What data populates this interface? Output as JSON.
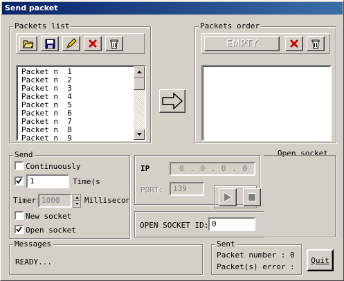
{
  "window": {
    "title": "Send packet",
    "close_glyph": "×"
  },
  "packets_list": {
    "legend": "Packets list",
    "items": [
      "Packet n  1",
      "Packet n  2",
      "Packet n  3",
      "Packet n  4",
      "Packet n  5",
      "Packet n  6",
      "Packet n  7",
      "Packet n  8",
      "Packet n  9"
    ],
    "toolbar_icons": [
      "open-folder-icon",
      "save-disk-icon",
      "edit-pencil-icon",
      "delete-x-icon",
      "trash-icon"
    ]
  },
  "packets_order": {
    "legend": "Packets order",
    "empty_label": "EMPTY"
  },
  "send": {
    "legend": "Send",
    "continuously_label": "Continuously",
    "continuously_checked": false,
    "times_checked": true,
    "times_value": "1",
    "times_label": "Time(s",
    "timer_label": "Timer:",
    "timer_value": "1000",
    "timer_unit": "Millisecond",
    "new_socket_label": "New socket",
    "new_socket_checked": false,
    "open_socket_label": "Open socket",
    "open_socket_checked": true
  },
  "connection": {
    "ip_label": "IP",
    "ip_value": "0 . 0 . 0 . 0",
    "port_label": "PORT:",
    "port_value": "139"
  },
  "open_socket_group": {
    "legend": "Open socket",
    "id_label": "OPEN SOCKET ID:",
    "id_value": "0"
  },
  "messages": {
    "legend": "Messages",
    "text": "READY..."
  },
  "sent": {
    "legend": "Sent",
    "packet_number_label": "Packet number : 0",
    "packet_error_label": "Packet(s) error  :"
  },
  "quit_label": "Quit",
  "colors": {
    "title_bar": "#0a246a",
    "face": "#d4d0c8",
    "delete_red": "#cc0000"
  }
}
